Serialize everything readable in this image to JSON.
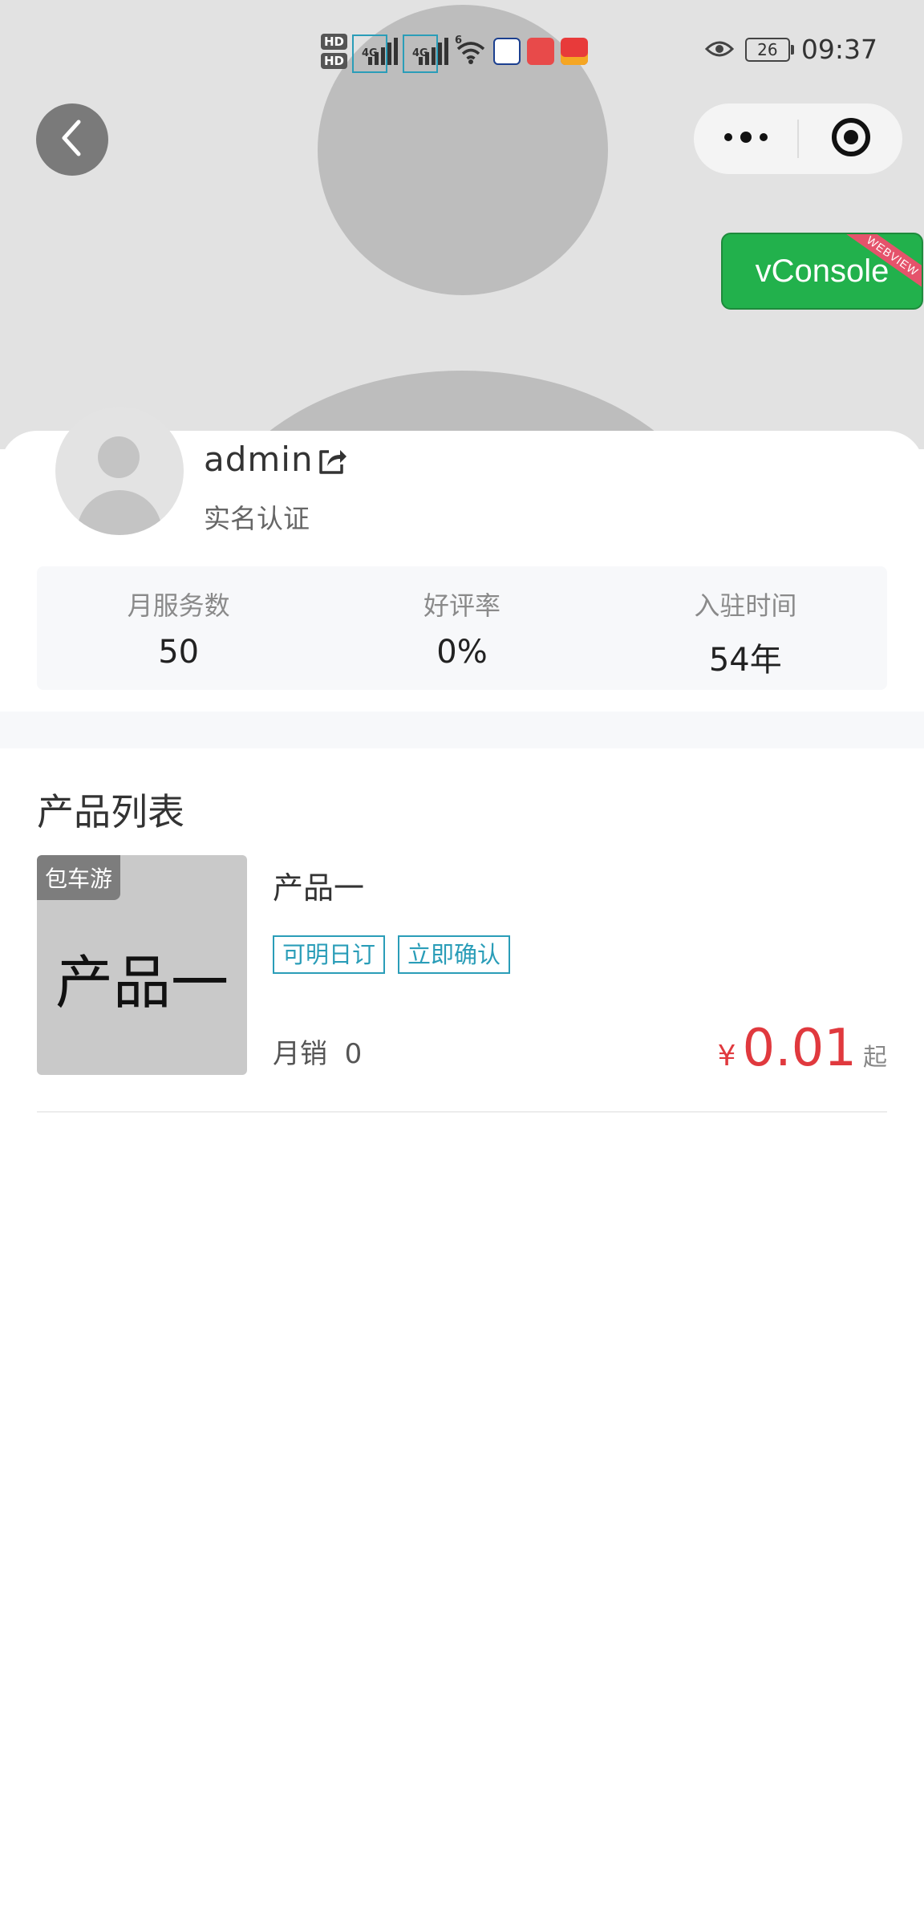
{
  "status_bar": {
    "hd1": "HD",
    "hd2": "HD",
    "sig1_tag": "4G",
    "sig2_tag": "4G",
    "wifi_tag": "6",
    "battery": "26",
    "time": "09:37"
  },
  "nav": {
    "vconsole_label": "vConsole",
    "vconsole_ribbon": "WEBVIEW"
  },
  "profile": {
    "username": "admin",
    "verification": "实名认证"
  },
  "stats": [
    {
      "label": "月服务数",
      "value": "50"
    },
    {
      "label": "好评率",
      "value": "0%"
    },
    {
      "label": "入驻时间",
      "value": "54年"
    }
  ],
  "products": {
    "section_title": "产品列表",
    "items": [
      {
        "thumb_tag": "包车游",
        "thumb_text": "产品一",
        "name": "产品一",
        "tags": [
          "可明日订",
          "立即确认"
        ],
        "sales": "月销  0",
        "currency": "¥",
        "price": "0.01",
        "price_suffix": "起"
      }
    ]
  },
  "colors": {
    "accent_green": "#22b14c",
    "price_red": "#e0393e",
    "tag_blue": "#2a9db8"
  }
}
